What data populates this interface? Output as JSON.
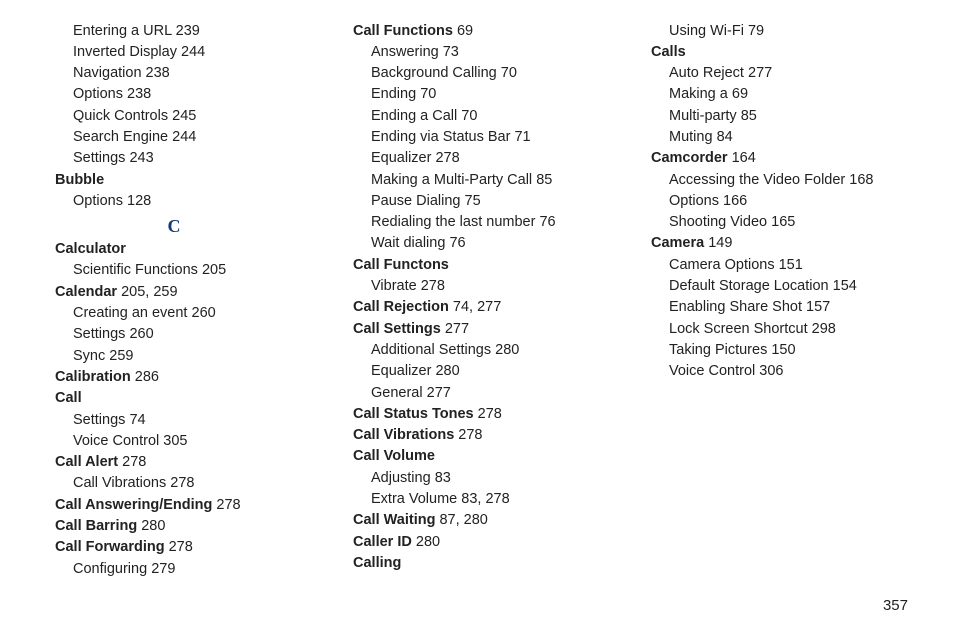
{
  "page_number": "357",
  "section_letter": "C",
  "entries": [
    {
      "type": "sub",
      "text": "Entering a URL",
      "page": "239"
    },
    {
      "type": "sub",
      "text": "Inverted Display",
      "page": "244"
    },
    {
      "type": "sub",
      "text": "Navigation",
      "page": "238"
    },
    {
      "type": "sub",
      "text": "Options",
      "page": "238"
    },
    {
      "type": "sub",
      "text": "Quick Controls",
      "page": "245"
    },
    {
      "type": "sub",
      "text": "Search Engine",
      "page": "244"
    },
    {
      "type": "sub",
      "text": "Settings",
      "page": "243"
    },
    {
      "type": "head",
      "text": "Bubble",
      "page": ""
    },
    {
      "type": "sub",
      "text": "Options",
      "page": "128"
    },
    {
      "type": "letter"
    },
    {
      "type": "head",
      "text": "Calculator",
      "page": ""
    },
    {
      "type": "sub",
      "text": "Scientific Functions",
      "page": "205"
    },
    {
      "type": "head",
      "text": "Calendar",
      "page": "205, 259"
    },
    {
      "type": "sub",
      "text": "Creating an event",
      "page": "260"
    },
    {
      "type": "sub",
      "text": "Settings",
      "page": "260"
    },
    {
      "type": "sub",
      "text": "Sync",
      "page": "259"
    },
    {
      "type": "head",
      "text": "Calibration",
      "page": "286"
    },
    {
      "type": "head",
      "text": "Call",
      "page": ""
    },
    {
      "type": "sub",
      "text": "Settings",
      "page": "74"
    },
    {
      "type": "sub",
      "text": "Voice Control",
      "page": "305"
    },
    {
      "type": "head",
      "text": "Call Alert",
      "page": "278"
    },
    {
      "type": "sub",
      "text": "Call Vibrations",
      "page": "278"
    },
    {
      "type": "head",
      "text": "Call Answering/Ending",
      "page": "278"
    },
    {
      "type": "head",
      "text": "Call Barring",
      "page": "280"
    },
    {
      "type": "head",
      "text": "Call Forwarding",
      "page": "278"
    },
    {
      "type": "sub",
      "text": "Configuring",
      "page": "279"
    },
    {
      "type": "head",
      "text": "Call Functions",
      "page": "69"
    },
    {
      "type": "sub",
      "text": "Answering",
      "page": "73"
    },
    {
      "type": "sub",
      "text": "Background Calling",
      "page": "70"
    },
    {
      "type": "sub",
      "text": "Ending",
      "page": "70"
    },
    {
      "type": "sub",
      "text": "Ending a Call",
      "page": "70"
    },
    {
      "type": "sub",
      "text": "Ending via Status Bar",
      "page": "71"
    },
    {
      "type": "sub",
      "text": "Equalizer",
      "page": "278"
    },
    {
      "type": "sub",
      "text": "Making a Multi-Party Call",
      "page": "85"
    },
    {
      "type": "sub",
      "text": "Pause Dialing",
      "page": "75"
    },
    {
      "type": "sub",
      "text": "Redialing the last number",
      "page": "76"
    },
    {
      "type": "sub",
      "text": "Wait dialing",
      "page": "76"
    },
    {
      "type": "head",
      "text": "Call Functons",
      "page": ""
    },
    {
      "type": "sub",
      "text": "Vibrate",
      "page": "278"
    },
    {
      "type": "head",
      "text": "Call Rejection",
      "page": "74, 277"
    },
    {
      "type": "head",
      "text": "Call Settings",
      "page": "277"
    },
    {
      "type": "sub",
      "text": "Additional Settings",
      "page": "280"
    },
    {
      "type": "sub",
      "text": "Equalizer",
      "page": "280"
    },
    {
      "type": "sub",
      "text": "General",
      "page": "277"
    },
    {
      "type": "head",
      "text": "Call Status Tones",
      "page": "278"
    },
    {
      "type": "head",
      "text": "Call Vibrations",
      "page": "278"
    },
    {
      "type": "head",
      "text": "Call Volume",
      "page": ""
    },
    {
      "type": "sub",
      "text": "Adjusting",
      "page": "83"
    },
    {
      "type": "sub",
      "text": "Extra Volume",
      "page": "83, 278"
    },
    {
      "type": "head",
      "text": "Call Waiting",
      "page": "87, 280"
    },
    {
      "type": "head",
      "text": "Caller ID",
      "page": "280"
    },
    {
      "type": "head",
      "text": "Calling",
      "page": ""
    },
    {
      "type": "sub",
      "text": "Using Wi-Fi",
      "page": "79"
    },
    {
      "type": "head",
      "text": "Calls",
      "page": ""
    },
    {
      "type": "sub",
      "text": "Auto Reject",
      "page": "277"
    },
    {
      "type": "sub",
      "text": "Making a",
      "page": "69"
    },
    {
      "type": "sub",
      "text": "Multi-party",
      "page": "85"
    },
    {
      "type": "sub",
      "text": "Muting",
      "page": "84"
    },
    {
      "type": "head",
      "text": "Camcorder",
      "page": "164"
    },
    {
      "type": "sub",
      "text": "Accessing the Video Folder",
      "page": "168"
    },
    {
      "type": "sub",
      "text": "Options",
      "page": "166"
    },
    {
      "type": "sub",
      "text": "Shooting Video",
      "page": "165"
    },
    {
      "type": "head",
      "text": "Camera",
      "page": "149"
    },
    {
      "type": "sub",
      "text": "Camera Options",
      "page": "151"
    },
    {
      "type": "sub",
      "text": "Default Storage Location",
      "page": "154"
    },
    {
      "type": "sub",
      "text": "Enabling Share Shot",
      "page": "157"
    },
    {
      "type": "sub",
      "text": "Lock Screen Shortcut",
      "page": "298"
    },
    {
      "type": "sub",
      "text": "Taking Pictures",
      "page": "150"
    },
    {
      "type": "sub",
      "text": "Voice Control",
      "page": "306"
    }
  ]
}
